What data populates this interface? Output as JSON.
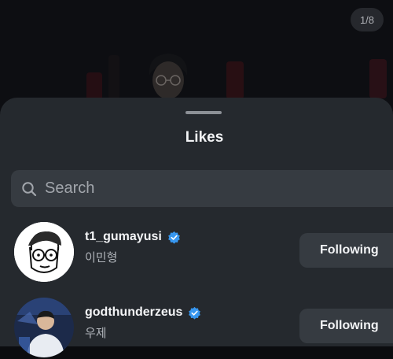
{
  "photo_counter": "1/8",
  "sheet": {
    "title": "Likes",
    "search": {
      "placeholder": "Search",
      "value": ""
    }
  },
  "users": [
    {
      "username": "t1_gumayusi",
      "full_name": "이민형",
      "verified": true,
      "button_label": "Following"
    },
    {
      "username": "godthunderzeus",
      "full_name": "우제",
      "verified": true,
      "button_label": "Following"
    }
  ],
  "colors": {
    "sheet_background": "#25292e",
    "field_background": "#363b41",
    "verified_blue": "#3797f0",
    "primary_text": "#f4f5f7",
    "secondary_text": "#b0b4ba"
  },
  "icons": [
    "search-icon",
    "verified-badge-icon"
  ]
}
